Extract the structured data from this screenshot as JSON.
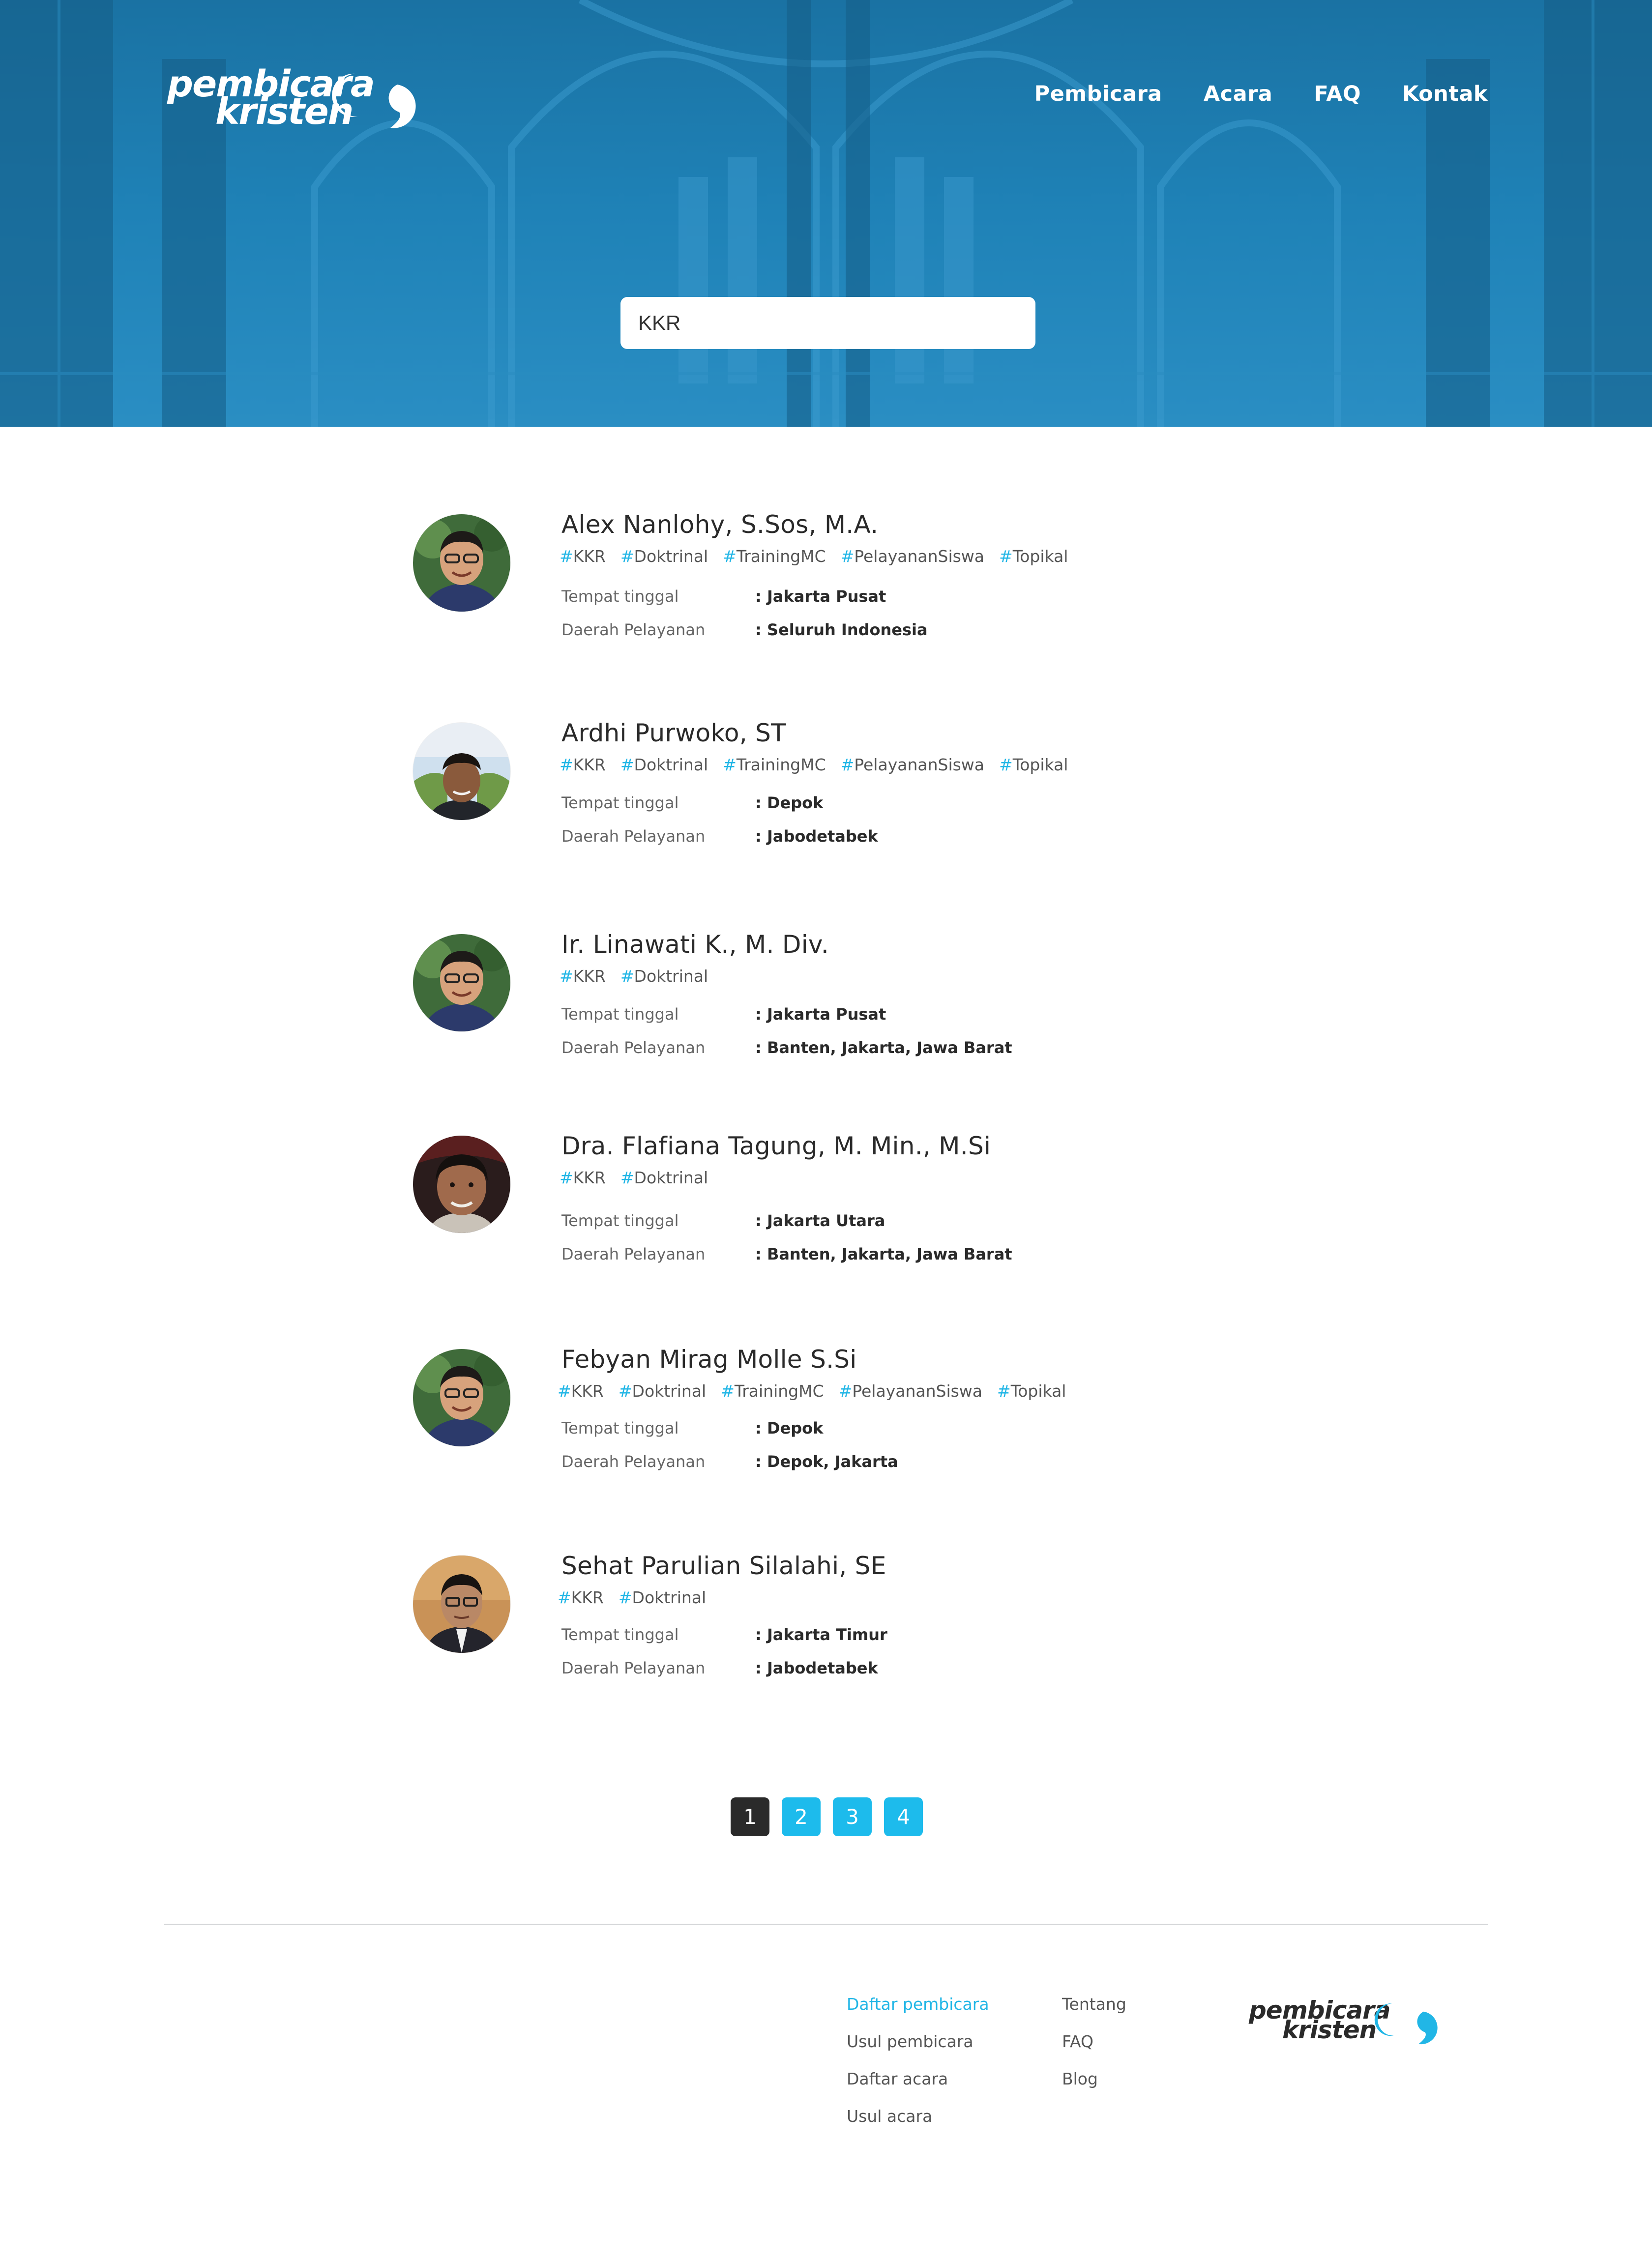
{
  "header": {
    "logo_line1": "pembicara",
    "logo_line2": "kristen",
    "nav": [
      "Pembicara",
      "Acara",
      "FAQ",
      "Kontak"
    ]
  },
  "search": {
    "value": "KKR"
  },
  "field_labels": {
    "residence": "Tempat tinggal",
    "service_area": "Daerah Pelayanan"
  },
  "speakers": [
    {
      "name": "Alex Nanlohy, S.Sos, M.A.",
      "tags": [
        "KKR",
        "Doktrinal",
        "TrainingMC",
        "PelayananSiswa",
        "Topikal"
      ],
      "residence": ": Jakarta Pusat",
      "service_area": ": Seluruh Indonesia"
    },
    {
      "name": "Ardhi Purwoko, ST",
      "tags": [
        "KKR",
        "Doktrinal",
        "TrainingMC",
        "PelayananSiswa",
        "Topikal"
      ],
      "residence": ": Depok",
      "service_area": ": Jabodetabek"
    },
    {
      "name": "Ir. Linawati K., M. Div.",
      "tags": [
        "KKR",
        "Doktrinal"
      ],
      "residence": ": Jakarta Pusat",
      "service_area": ": Banten, Jakarta, Jawa Barat"
    },
    {
      "name": "Dra. Flafiana Tagung, M. Min., M.Si",
      "tags": [
        "KKR",
        "Doktrinal"
      ],
      "residence": ": Jakarta Utara",
      "service_area": ": Banten, Jakarta, Jawa Barat"
    },
    {
      "name": "Febyan Mirag Molle S.Si",
      "tags": [
        "KKR",
        "Doktrinal",
        "TrainingMC",
        "PelayananSiswa",
        "Topikal"
      ],
      "residence": ": Depok",
      "service_area": ": Depok, Jakarta"
    },
    {
      "name": "Sehat Parulian Silalahi, SE",
      "tags": [
        "KKR",
        "Doktrinal"
      ],
      "residence": ": Jakarta Timur",
      "service_area": ": Jabodetabek"
    }
  ],
  "pagination": {
    "pages": [
      "1",
      "2",
      "3",
      "4"
    ],
    "current": "1"
  },
  "footer": {
    "col1": [
      "Daftar pembicara",
      "Usul pembicara",
      "Daftar acara",
      "Usul acara"
    ],
    "col2": [
      "Tentang",
      "FAQ",
      "Blog"
    ],
    "current": "Daftar pembicara",
    "logo_line1": "pembicara",
    "logo_line2": "kristen"
  },
  "colors": {
    "hero": "#1f7fb3",
    "accent": "#21b6e6",
    "page_button": "#1dbbec",
    "page_button_active": "#2a2a2a",
    "text_dark": "#2a2a2a"
  },
  "icons": {
    "logo_mark": "speech-bubbles-icon"
  }
}
